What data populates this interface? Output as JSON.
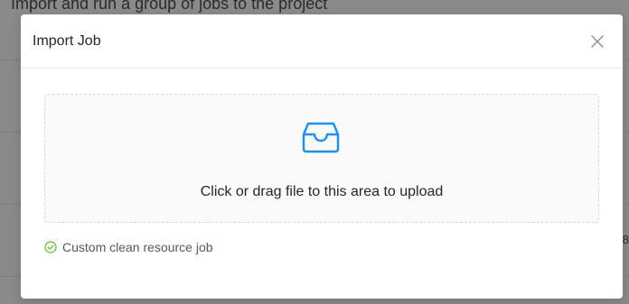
{
  "background": {
    "partial_top_text": "Import and run a group of jobs to the project",
    "edge_char": "8"
  },
  "modal": {
    "title": "Import Job",
    "close_icon": "close-icon",
    "dropzone": {
      "icon": "inbox-icon",
      "hint": "Click or drag file to this area to upload"
    },
    "uploaded_files": [
      {
        "name": "Custom clean resource job",
        "status": "success",
        "icon": "check-circle-icon"
      }
    ]
  },
  "colors": {
    "accent": "#1890ff",
    "success": "#52c41a",
    "overlay": "#8a8a8a"
  }
}
